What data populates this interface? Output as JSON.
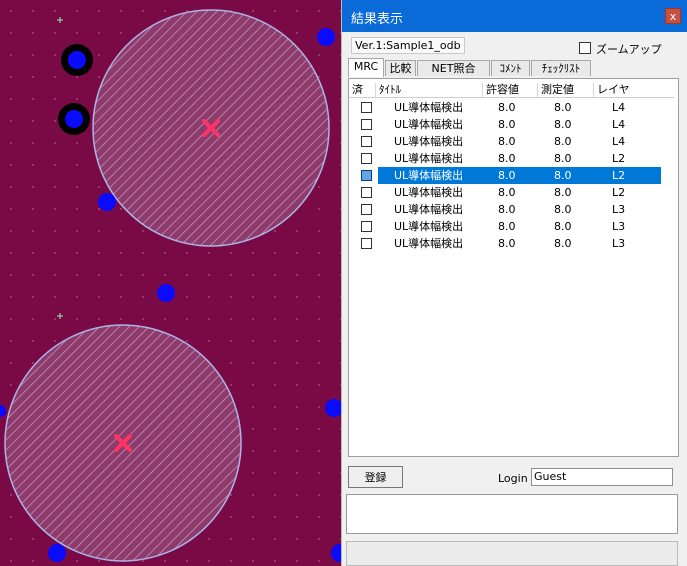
{
  "colors": {
    "board": "#7a0a45",
    "pad": "#0a0aff",
    "ring": "#000000",
    "marker": "#ff3366",
    "clearance_ring": "#a9b4e8",
    "selection": "#0078d7"
  },
  "canvas": {
    "markers": [
      "x-mark-icon",
      "x-mark-icon"
    ]
  },
  "window": {
    "title": "結果表示",
    "close": "x"
  },
  "version_label": "Ver.1:Sample1_odb",
  "zoom_checkbox": {
    "label": "ズームアップ",
    "checked": false
  },
  "tabs": [
    "MRC",
    "比較",
    "NET照合",
    "ｺﾒﾝﾄ",
    "ﾁｪｯｸﾘｽﾄ"
  ],
  "active_tab": 0,
  "columns": [
    "済",
    "ﾀｲﾄﾙ",
    "許容値",
    "測定値",
    "レイヤ"
  ],
  "rows": [
    {
      "done": false,
      "title": "UL導体幅検出",
      "allowed": "8.0",
      "measured": "8.0",
      "layer": "L4",
      "selected": false
    },
    {
      "done": false,
      "title": "UL導体幅検出",
      "allowed": "8.0",
      "measured": "8.0",
      "layer": "L4",
      "selected": false
    },
    {
      "done": false,
      "title": "UL導体幅検出",
      "allowed": "8.0",
      "measured": "8.0",
      "layer": "L4",
      "selected": false
    },
    {
      "done": false,
      "title": "UL導体幅検出",
      "allowed": "8.0",
      "measured": "8.0",
      "layer": "L2",
      "selected": false
    },
    {
      "done": false,
      "title": "UL導体幅検出",
      "allowed": "8.0",
      "measured": "8.0",
      "layer": "L2",
      "selected": true
    },
    {
      "done": false,
      "title": "UL導体幅検出",
      "allowed": "8.0",
      "measured": "8.0",
      "layer": "L2",
      "selected": false
    },
    {
      "done": false,
      "title": "UL導体幅検出",
      "allowed": "8.0",
      "measured": "8.0",
      "layer": "L3",
      "selected": false
    },
    {
      "done": false,
      "title": "UL導体幅検出",
      "allowed": "8.0",
      "measured": "8.0",
      "layer": "L3",
      "selected": false
    },
    {
      "done": false,
      "title": "UL導体幅検出",
      "allowed": "8.0",
      "measured": "8.0",
      "layer": "L3",
      "selected": false
    }
  ],
  "register_button": "登録",
  "login": {
    "label": "Login",
    "value": "Guest"
  }
}
